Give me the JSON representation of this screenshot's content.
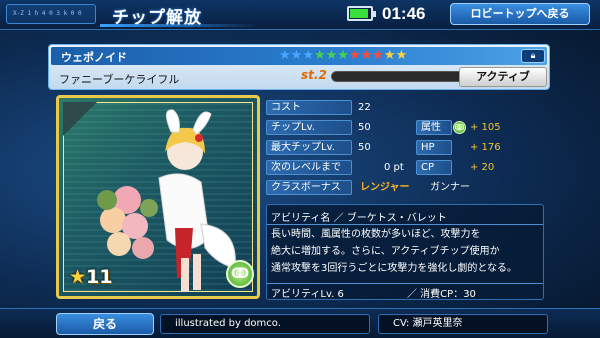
{
  "header": {
    "title": "チップ解放",
    "deco_text": "X-Z 1 h 4 0 3 k 0 0",
    "clock": "01:46",
    "lobby_button": "ロビートップへ戻る",
    "battery_level": 0.9
  },
  "chip": {
    "type": "ウェポノイド",
    "name": "ファニーブーケライフル",
    "stage": "st.2",
    "active_button": "アクティブ",
    "stars": [
      {
        "char": "★",
        "color": "#4aa6ff"
      },
      {
        "char": "★",
        "color": "#4aa6ff"
      },
      {
        "char": "★",
        "color": "#4aa6ff"
      },
      {
        "char": "★",
        "color": "#44d44a"
      },
      {
        "char": "★",
        "color": "#44d44a"
      },
      {
        "char": "★",
        "color": "#44d44a"
      },
      {
        "char": "★",
        "color": "#ff4a3a"
      },
      {
        "char": "★",
        "color": "#ff4a3a"
      },
      {
        "char": "★",
        "color": "#ff4a3a"
      },
      {
        "char": "★",
        "color": "#ffd33a"
      },
      {
        "char": "★",
        "color": "#ffd33a"
      }
    ],
    "lock_icon": "lock-icon"
  },
  "card": {
    "rarity": "11",
    "element_icon": "wind-icon"
  },
  "stats": {
    "cost_label": "コスト",
    "cost": "22",
    "chip_lv_label": "チップLv.",
    "chip_lv": "50",
    "max_lv_label": "最大チップLv.",
    "max_lv": "50",
    "next_label": "次のレベルまで",
    "next": "0 pt",
    "class_label": "クラスボーナス",
    "class1": "レンジャー",
    "class2": "ガンナー",
    "attr_label": "属性",
    "attr": "+ 105",
    "hp_label": "HP",
    "hp": "+ 176",
    "cp_label": "CP",
    "cp": "+ 20"
  },
  "ability": {
    "title": "アビリティ名 ／ ブーケトス・バレット",
    "lines": [
      "長い時間、風属性の枚数が多いほど、攻撃力を",
      "絶大に増加する。さらに、アクティブチップ使用か",
      "通常攻撃を3回行うごとに攻撃力を強化し劇的となる。"
    ],
    "level": "アビリティLv.  6",
    "cost": "／  消費CP：30"
  },
  "footer": {
    "back_button": "戻る",
    "credit": "illustrated by  domco.",
    "cv": "CV: 瀬戸英里奈"
  },
  "colors": {
    "accent": "#2d6fb3",
    "gold": "#e9c94a",
    "orange": "#ffb21e"
  }
}
